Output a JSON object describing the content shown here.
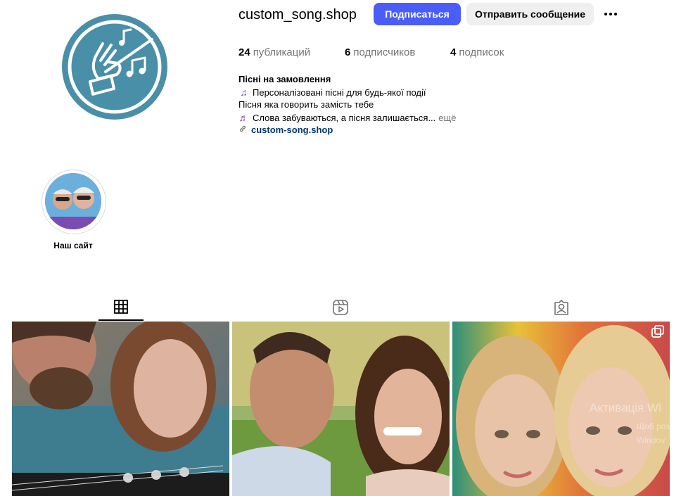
{
  "profile": {
    "username": "custom_song.shop",
    "follow_label": "Подписаться",
    "message_label": "Отправить сообщение",
    "more_icon": "more-options-icon"
  },
  "stats": {
    "posts_count": "24",
    "posts_label": "публикаций",
    "followers_count": "6",
    "followers_label": "подписчиков",
    "following_count": "4",
    "following_label": "подписок"
  },
  "bio": {
    "name": "Пісні на замовлення",
    "line1": "Персоналізовані пісні для будь-якої події",
    "line2": "Пісня яка говорить замість тебе",
    "line3": "Слова забуваються, а пісня залишається...",
    "more": "ещё",
    "link": "custom-song.shop"
  },
  "highlight": {
    "label": "Наш сайт"
  },
  "tabs": [
    {
      "name": "posts",
      "icon": "grid-icon",
      "active": true
    },
    {
      "name": "reels",
      "icon": "reels-icon",
      "active": false
    },
    {
      "name": "tagged",
      "icon": "tagged-icon",
      "active": false
    }
  ],
  "watermark": {
    "line1": "Активація Wi",
    "line2": "Щоб розд",
    "line3": "Windov"
  },
  "colors": {
    "accent": "#4a5df9",
    "link": "#00376b",
    "avatar_bg": "#4a8fa8"
  }
}
